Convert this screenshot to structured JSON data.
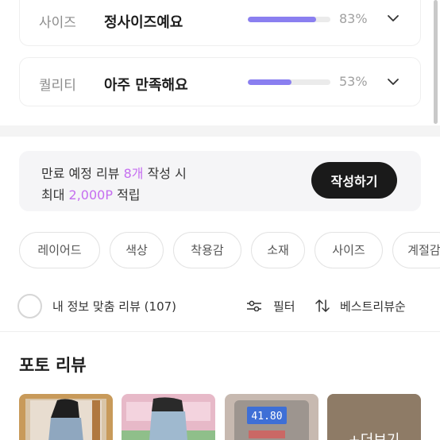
{
  "ratings": {
    "size": {
      "label": "사이즈",
      "value": "정사이즈예요",
      "percent_text": "83%",
      "percent": 0.83
    },
    "quality": {
      "label": "퀄리티",
      "value": "아주 만족해요",
      "percent_text": "53%",
      "percent": 0.53
    }
  },
  "banner": {
    "line1_prefix": "만료 예정 리뷰 ",
    "line1_highlight": "8개",
    "line1_suffix": " 작성 시",
    "line2_prefix": "최대 ",
    "line2_highlight": "2,000P",
    "line2_suffix": " 적립",
    "button": "작성하기"
  },
  "chips": [
    "레이어드",
    "색상",
    "착용감",
    "소재",
    "사이즈",
    "계절감"
  ],
  "filter_bar": {
    "my_info_label": "내 정보 맞춤 리뷰 (107)",
    "filter_label": "필터",
    "sort_label": "베스트리뷰순"
  },
  "photo_review": {
    "title": "포토 리뷰",
    "scale_reading": "41.80",
    "more_label": "+더보기"
  },
  "colors": {
    "accent": "#8a7ff0",
    "highlight": "#c56ef0",
    "button_bg": "#1a1a1a"
  }
}
